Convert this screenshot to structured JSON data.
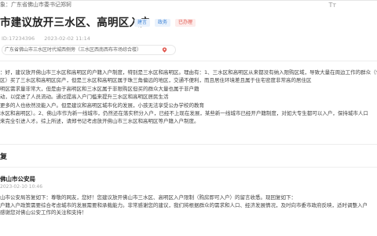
{
  "header": {
    "to_label": "象：广东省佛山市委书记郑轲",
    "font_toggle": "Tт"
  },
  "post": {
    "title": "市建议放开三水区、高明区入户",
    "tags": [
      "建言",
      "政务",
      "已办理"
    ],
    "id": "ID:17234396",
    "datetime": "2023-02-02 11:14",
    "location": "广东省佛山市三水区时代城西侧旁（三水区西南西布市场综合楼）",
    "body_lines": [
      "：好，建议放开佛山市三水区和高明区的户籍入户制度，特别是三水区和高明区。理由有：1、三水区和高明区从来都没有纳入限购区域，导致大量在周边工作的群众（包",
      "区）买了三水区和高明区房产，但是三水区和高明区属于珠三角偏远的地区，交通不便利，而且居住环境差且属于住宅密度非常高的居住区，这导致大量想在三水区和",
      "明区需求量非常大，但是由于高明区和三水区属于非限购区但买的群众大量也属于非户籍，使大部分房产资源闲置非常浪费，给当地政府带来了极大的负担，也造成了大",
      "动，以促进了人员流动。通过提高入户门槛来提升三水区和高明区居民生活，但是三水区和高明区不能提升人口户籍，导致大部分房产出租率较低，而且有一些小区居民非",
      "更多的人也依然没能入户。但是建议和高明区城市化的发展，小孩无法享受公办学校的教育，急需放开三水区和高明区入户。",
      "水区和高明区）。2、佛山市作为新一线城市，仍然还在落实积分入户，已经不上现在发展，某些新一线城市已经开户籍制度，对如大专生都可以入户，保持城市人口",
      "来完全引进人才。综上所述，请郑书记考虑放开佛山市三水区和高明区等户籍入户制度。"
    ],
    "body_lines_visible": [
      "：好，建议放开佛山市三水区和高明区的户籍入户制度，特别是三水区和高明区。理由有：1、三水区和高明区从来都没有纳入限购区域，导致大量在周边工作的群众（包",
      "区）买了三水区和高明区房产，但是三水区和高明区属于珠三角偏远的地区，交通不便利，而且居住环境差且属于住宅密度非常高的居住区",
      "明区需求量非常大，但是由于高明区和三水区属于非限购区但买的群众大量也属于非户籍",
      "动，以促进了人员流动。通过提高入户门槛来提升三水区和高明区居民生活",
      "更多的人也依然没能入户。但是建议和高明区城市化的发展，小孩无法享受公办学校的教育",
      "水区和高明区）。2、佛山市作为新一线城市，仍然还在落实积分入户，已经不上现在发展，某些新一线城市已经开户籍制度，对如大专生都可以入户，保持城市人口",
      "来完全引进人才。综上所述，请郑书记考虑放开佛山市三水区和高明区等户籍入户制度。"
    ]
  },
  "reply": {
    "heading": "复",
    "org": "佛山市公安局",
    "datetime": "2023-02-10 10:46",
    "lines": [
      "山市公安局答复如下：尊敬的网友，您好！您建议放开佛山市三水区、高明区入户限制（购房即可入户）的留言收悉。现回复如下：",
      "户籍入户政策需要综合考虑城市的发展需要和承载能力。非常感谢您的建议，我们将根据群众的需求和人口、经济发展情况，及时向市委市政府反映，适时调整入户",
      "感谢您对佛山公安工作的关注和支持！"
    ]
  }
}
